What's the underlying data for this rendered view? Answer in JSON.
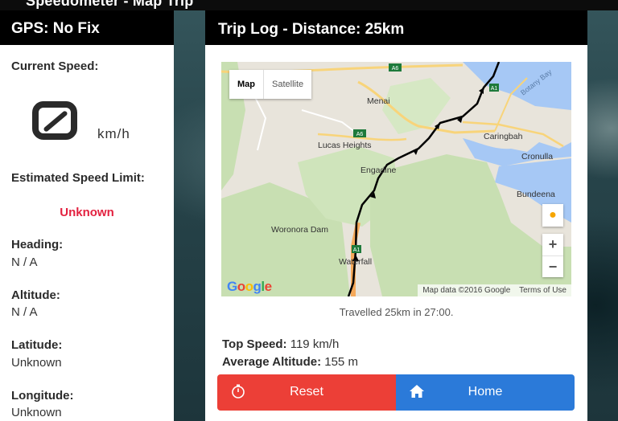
{
  "app": {
    "top_title": "Speedometer - Map Trip"
  },
  "left_panel": {
    "header": "GPS: No Fix",
    "current_speed_label": "Current Speed:",
    "speed_unit": "km/h",
    "speed_limit_label": "Estimated Speed Limit:",
    "speed_limit_value": "Unknown",
    "heading_label": "Heading:",
    "heading_value": "N / A",
    "altitude_label": "Altitude:",
    "altitude_value": "N / A",
    "latitude_label": "Latitude:",
    "latitude_value": "Unknown",
    "longitude_label": "Longitude:",
    "longitude_value": "Unknown"
  },
  "trip": {
    "header": "Trip Log - Distance: 25km",
    "travelled_text": "Travelled 25km in 27:00.",
    "top_speed_label": "Top Speed:",
    "top_speed_value": "119 km/h",
    "avg_altitude_label": "Average Altitude:",
    "avg_altitude_value": "155 m",
    "reset_label": "Reset",
    "home_label": "Home"
  },
  "map": {
    "type_map": "Map",
    "type_satellite": "Satellite",
    "attribution": "Map data ©2016 Google",
    "terms": "Terms of Use",
    "google_logo": "Google",
    "zoom_in": "+",
    "zoom_out": "−",
    "place_labels": [
      "Menai",
      "Caringbah",
      "Cronulla",
      "Lucas Heights",
      "Engadine",
      "Bundeena",
      "Woronora Dam",
      "Waterfall",
      "Botany Bay",
      "A6",
      "A1"
    ]
  },
  "colors": {
    "reset": "#ec3f37",
    "home": "#2b7ad9",
    "limit_unknown": "#e32240"
  },
  "icons": [
    "speedometer-icon",
    "stopwatch-icon",
    "home-icon",
    "pegman-icon"
  ]
}
